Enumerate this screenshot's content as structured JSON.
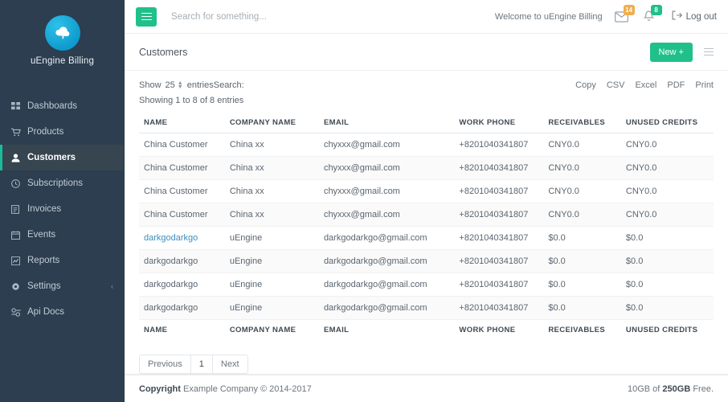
{
  "sidebar": {
    "brand": {
      "name": "uEngine Billing",
      "logo_icon": "cloud-icon"
    },
    "items": [
      {
        "label": "Dashboards",
        "icon": "grid-icon",
        "active": false
      },
      {
        "label": "Products",
        "icon": "cart-icon",
        "active": false
      },
      {
        "label": "Customers",
        "icon": "user-icon",
        "active": true
      },
      {
        "label": "Subscriptions",
        "icon": "clock-icon",
        "active": false
      },
      {
        "label": "Invoices",
        "icon": "file-icon",
        "active": false
      },
      {
        "label": "Events",
        "icon": "calendar-icon",
        "active": false
      },
      {
        "label": "Reports",
        "icon": "chart-line-icon",
        "active": false
      },
      {
        "label": "Settings",
        "icon": "gear-icon",
        "active": false,
        "chevron": "‹"
      },
      {
        "label": "Api Docs",
        "icon": "sliders-icon",
        "active": false
      }
    ]
  },
  "topbar": {
    "menu_icon": "hamburger-icon",
    "search_placeholder": "Search for something...",
    "search_value": "",
    "welcome": "Welcome to uEngine Billing",
    "mail_badge": "14",
    "bell_badge": "8",
    "logout_label": "Log out",
    "accent_green": "#21c08a",
    "badge_orange": "#f0ad4e"
  },
  "card": {
    "title": "Customers",
    "new_button": "New +",
    "list_icon": "list-icon"
  },
  "datatable": {
    "show_label": "Show",
    "page_length": "25",
    "entries_label": "entriesSearch:",
    "search_value": "",
    "info": "Showing 1 to 8 of 8 entries",
    "export_buttons": [
      "Copy",
      "CSV",
      "Excel",
      "PDF",
      "Print"
    ],
    "columns": [
      "NAME",
      "COMPANY NAME",
      "EMAIL",
      "WORK PHONE",
      "RECEIVABLES",
      "UNUSED CREDITS"
    ],
    "rows": [
      {
        "name": "China Customer",
        "company": "China xx",
        "email": "chyxxx@gmail.com",
        "phone": "+8201040341807",
        "receivables": "CNY0.0",
        "credits": "CNY0.0",
        "link": false
      },
      {
        "name": "China Customer",
        "company": "China xx",
        "email": "chyxxx@gmail.com",
        "phone": "+8201040341807",
        "receivables": "CNY0.0",
        "credits": "CNY0.0",
        "link": false
      },
      {
        "name": "China Customer",
        "company": "China xx",
        "email": "chyxxx@gmail.com",
        "phone": "+8201040341807",
        "receivables": "CNY0.0",
        "credits": "CNY0.0",
        "link": false
      },
      {
        "name": "China Customer",
        "company": "China xx",
        "email": "chyxxx@gmail.com",
        "phone": "+8201040341807",
        "receivables": "CNY0.0",
        "credits": "CNY0.0",
        "link": false
      },
      {
        "name": "darkgodarkgo",
        "company": "uEngine",
        "email": "darkgodarkgo@gmail.com",
        "phone": "+8201040341807",
        "receivables": "$0.0",
        "credits": "$0.0",
        "link": true
      },
      {
        "name": "darkgodarkgo",
        "company": "uEngine",
        "email": "darkgodarkgo@gmail.com",
        "phone": "+8201040341807",
        "receivables": "$0.0",
        "credits": "$0.0",
        "link": false
      },
      {
        "name": "darkgodarkgo",
        "company": "uEngine",
        "email": "darkgodarkgo@gmail.com",
        "phone": "+8201040341807",
        "receivables": "$0.0",
        "credits": "$0.0",
        "link": false
      },
      {
        "name": "darkgodarkgo",
        "company": "uEngine",
        "email": "darkgodarkgo@gmail.com",
        "phone": "+8201040341807",
        "receivables": "$0.0",
        "credits": "$0.0",
        "link": false
      }
    ],
    "pagination": {
      "previous": "Previous",
      "pages": [
        "1"
      ],
      "next": "Next"
    }
  },
  "footer": {
    "copyright_strong": "Copyright",
    "copyright_rest": " Example Company © 2014-2017",
    "storage_prefix": "10GB of ",
    "storage_strong": "250GB",
    "storage_suffix": " Free."
  }
}
